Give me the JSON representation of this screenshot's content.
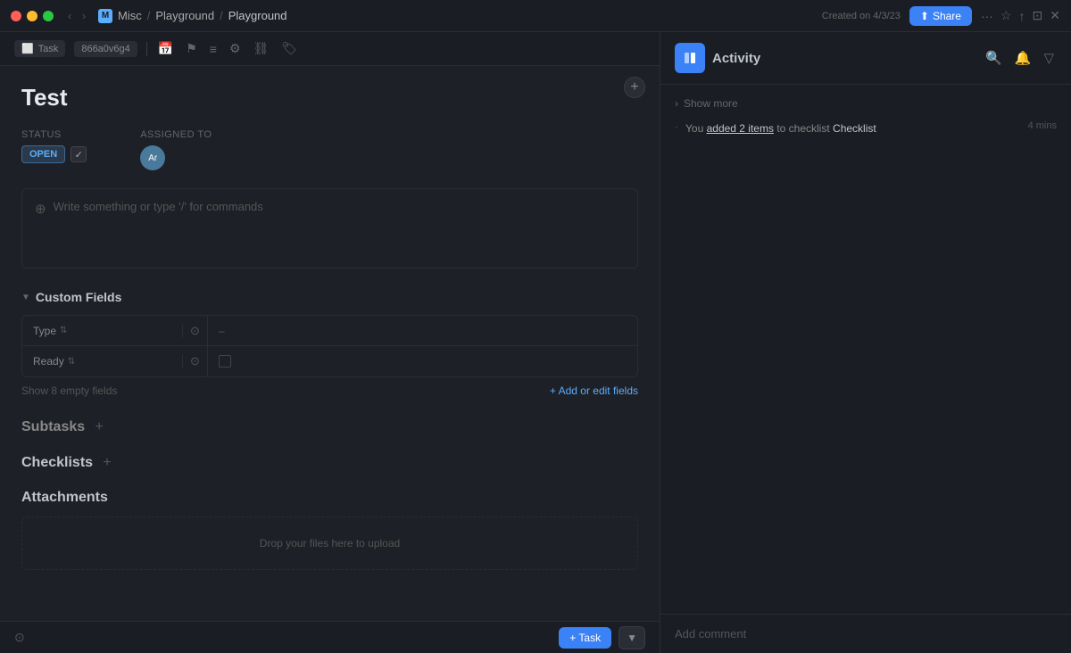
{
  "titlebar": {
    "breadcrumb": [
      "Misc",
      "Playground",
      "Playground"
    ],
    "created_date": "Created on 4/3/23",
    "share_label": "Share"
  },
  "toolbar": {
    "task_label": "Task",
    "task_id": "866a0v6g4"
  },
  "task": {
    "title": "Test",
    "status_label": "Status",
    "status_value": "OPEN",
    "assigned_label": "Assigned to",
    "assigned_initials": "Ar",
    "editor_placeholder": "Write something or type '/' for commands"
  },
  "custom_fields": {
    "section_title": "Custom Fields",
    "fields": [
      {
        "name": "Type",
        "value": "–"
      },
      {
        "name": "Ready",
        "value": ""
      }
    ],
    "show_empty_label": "Show 8 empty fields",
    "add_edit_label": "+ Add or edit fields"
  },
  "subtasks": {
    "title": "Subtasks",
    "add_label": "+"
  },
  "checklists": {
    "title": "Checklists",
    "add_label": "+"
  },
  "attachments": {
    "title": "Attachments",
    "drop_label": "Drop your files here to upload"
  },
  "activity": {
    "title": "Activity",
    "show_more_label": "Show more",
    "items": [
      {
        "text_before": "You ",
        "link_text": "added 2 items",
        "text_after": " to checklist ",
        "checklist_name": "Checklist",
        "time": "4 mins"
      }
    ],
    "comment_placeholder": "Add comment"
  },
  "bottom": {
    "add_task_label": "+ Task"
  }
}
